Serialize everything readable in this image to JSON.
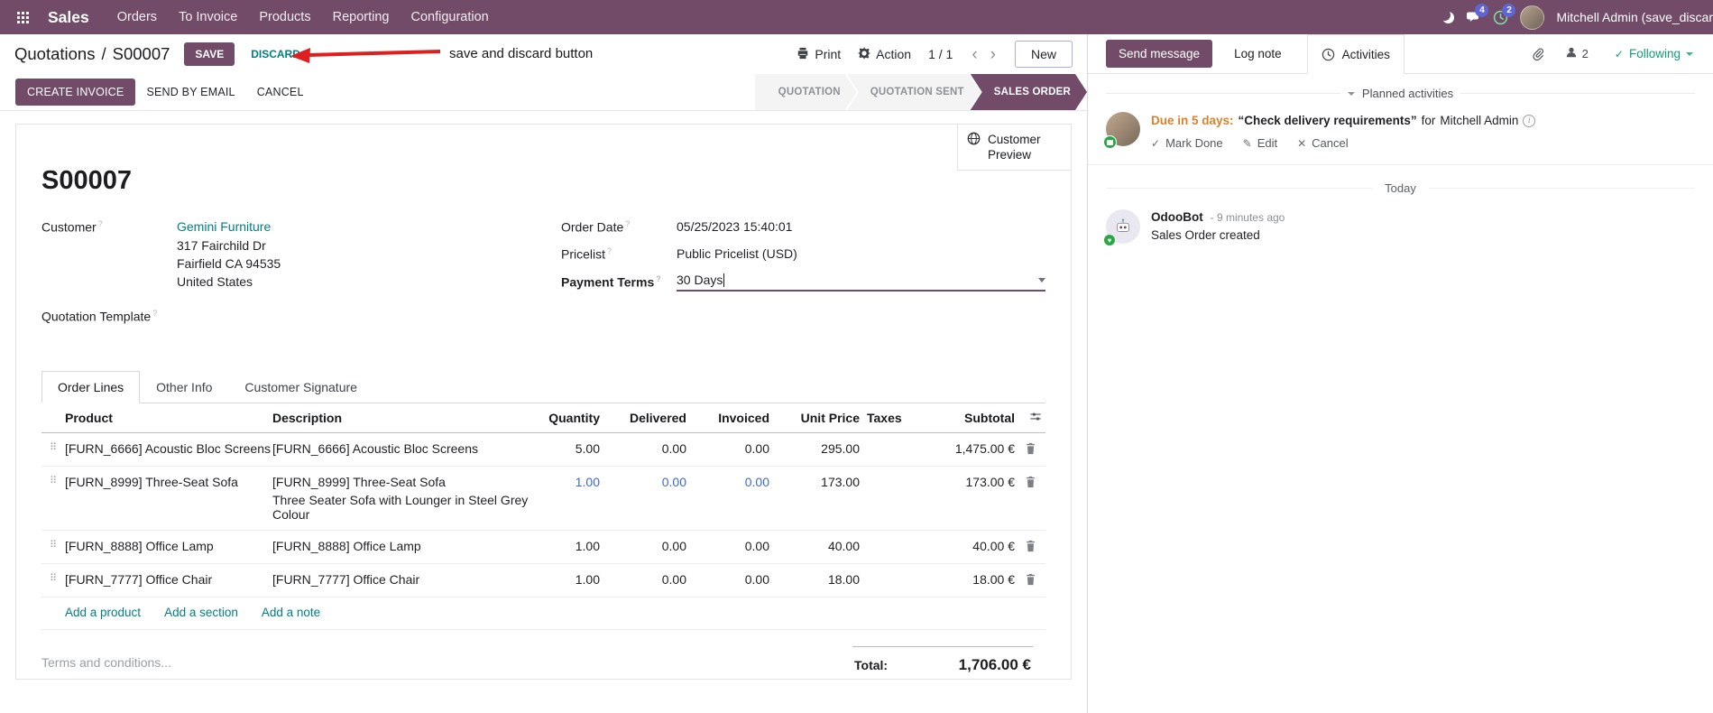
{
  "colors": {
    "brand": "#714B67",
    "link": "#017e84",
    "modified": "#3d6ad2",
    "due": "#d9822b",
    "arrow": "#dd1f1f",
    "following": "#0f9d7a"
  },
  "ui": {
    "help_marker": "?"
  },
  "navbar": {
    "app_name": "Sales",
    "menus": [
      "Orders",
      "To Invoice",
      "Products",
      "Reporting",
      "Configuration"
    ],
    "systray": {
      "messages_badge": "4",
      "activities_badge": "2",
      "user_name": "Mitchell Admin (save_discar"
    }
  },
  "control_panel": {
    "breadcrumb_parent": "Quotations",
    "breadcrumb_separator": "/",
    "breadcrumb_current": "S00007",
    "save_label": "SAVE",
    "discard_label": "DISCARD",
    "print_label": "Print",
    "action_label": "Action",
    "pager": "1 / 1",
    "pager_prev": "‹",
    "pager_next": "›",
    "new_label": "New"
  },
  "annotation": {
    "text": "save and discard button"
  },
  "statusbar": {
    "create_invoice": "CREATE INVOICE",
    "send_by_email": "SEND BY EMAIL",
    "cancel": "CANCEL",
    "steps": [
      {
        "label": "QUOTATION",
        "active": false
      },
      {
        "label": "QUOTATION SENT",
        "active": false
      },
      {
        "label": "SALES ORDER",
        "active": true
      }
    ]
  },
  "sheet": {
    "customer_preview": "Customer Preview",
    "title": "S00007",
    "customer": {
      "label": "Customer",
      "name": "Gemini Furniture",
      "address_lines": [
        "317 Fairchild Dr",
        "Fairfield CA 94535",
        "United States"
      ]
    },
    "quotation_template_label": "Quotation Template",
    "order_date": {
      "label": "Order Date",
      "value": "05/25/2023 15:40:01"
    },
    "pricelist": {
      "label": "Pricelist",
      "value": "Public Pricelist (USD)"
    },
    "payment_terms": {
      "label": "Payment Terms",
      "value": "30 Days"
    },
    "tabs": [
      {
        "label": "Order Lines",
        "active": true
      },
      {
        "label": "Other Info",
        "active": false
      },
      {
        "label": "Customer Signature",
        "active": false
      }
    ],
    "order_lines": {
      "columns": {
        "product": "Product",
        "description": "Description",
        "quantity": "Quantity",
        "delivered": "Delivered",
        "invoiced": "Invoiced",
        "unit_price": "Unit Price",
        "taxes": "Taxes",
        "subtotal": "Subtotal"
      },
      "rows": [
        {
          "product": "[FURN_6666] Acoustic Bloc Screens",
          "description": "[FURN_6666] Acoustic Bloc Screens",
          "description2": "",
          "quantity": "5.00",
          "delivered": "0.00",
          "invoiced": "0.00",
          "unit_price": "295.00",
          "taxes": "",
          "subtotal": "1,475.00 €",
          "modified": false
        },
        {
          "product": "[FURN_8999] Three-Seat Sofa",
          "description": "[FURN_8999] Three-Seat Sofa",
          "description2": "Three Seater Sofa with Lounger in Steel Grey Colour",
          "quantity": "1.00",
          "delivered": "0.00",
          "invoiced": "0.00",
          "unit_price": "173.00",
          "taxes": "",
          "subtotal": "173.00 €",
          "modified": true
        },
        {
          "product": "[FURN_8888] Office Lamp",
          "description": "[FURN_8888] Office Lamp",
          "description2": "",
          "quantity": "1.00",
          "delivered": "0.00",
          "invoiced": "0.00",
          "unit_price": "40.00",
          "taxes": "",
          "subtotal": "40.00 €",
          "modified": false
        },
        {
          "product": "[FURN_7777] Office Chair",
          "description": "[FURN_7777] Office Chair",
          "description2": "",
          "quantity": "1.00",
          "delivered": "0.00",
          "invoiced": "0.00",
          "unit_price": "18.00",
          "taxes": "",
          "subtotal": "18.00 €",
          "modified": false
        }
      ],
      "footer_links": [
        "Add a product",
        "Add a section",
        "Add a note"
      ]
    },
    "terms_placeholder": "Terms and conditions...",
    "total_label": "Total:",
    "total_value": "1,706.00 €"
  },
  "chatter": {
    "send_message": "Send message",
    "log_note": "Log note",
    "activities_tab": "Activities",
    "followers_count": "2",
    "following": "Following",
    "planned_header": "Planned activities",
    "activity": {
      "due": "Due in 5 days:",
      "summary": "“Check delivery requirements”",
      "for_label": "for",
      "assignee": "Mitchell Admin",
      "mark_done": "Mark Done",
      "edit": "Edit",
      "cancel": "Cancel"
    },
    "day_divider": "Today",
    "message": {
      "author": "OdooBot",
      "timestamp": "- 9 minutes ago",
      "body": "Sales Order created"
    }
  }
}
